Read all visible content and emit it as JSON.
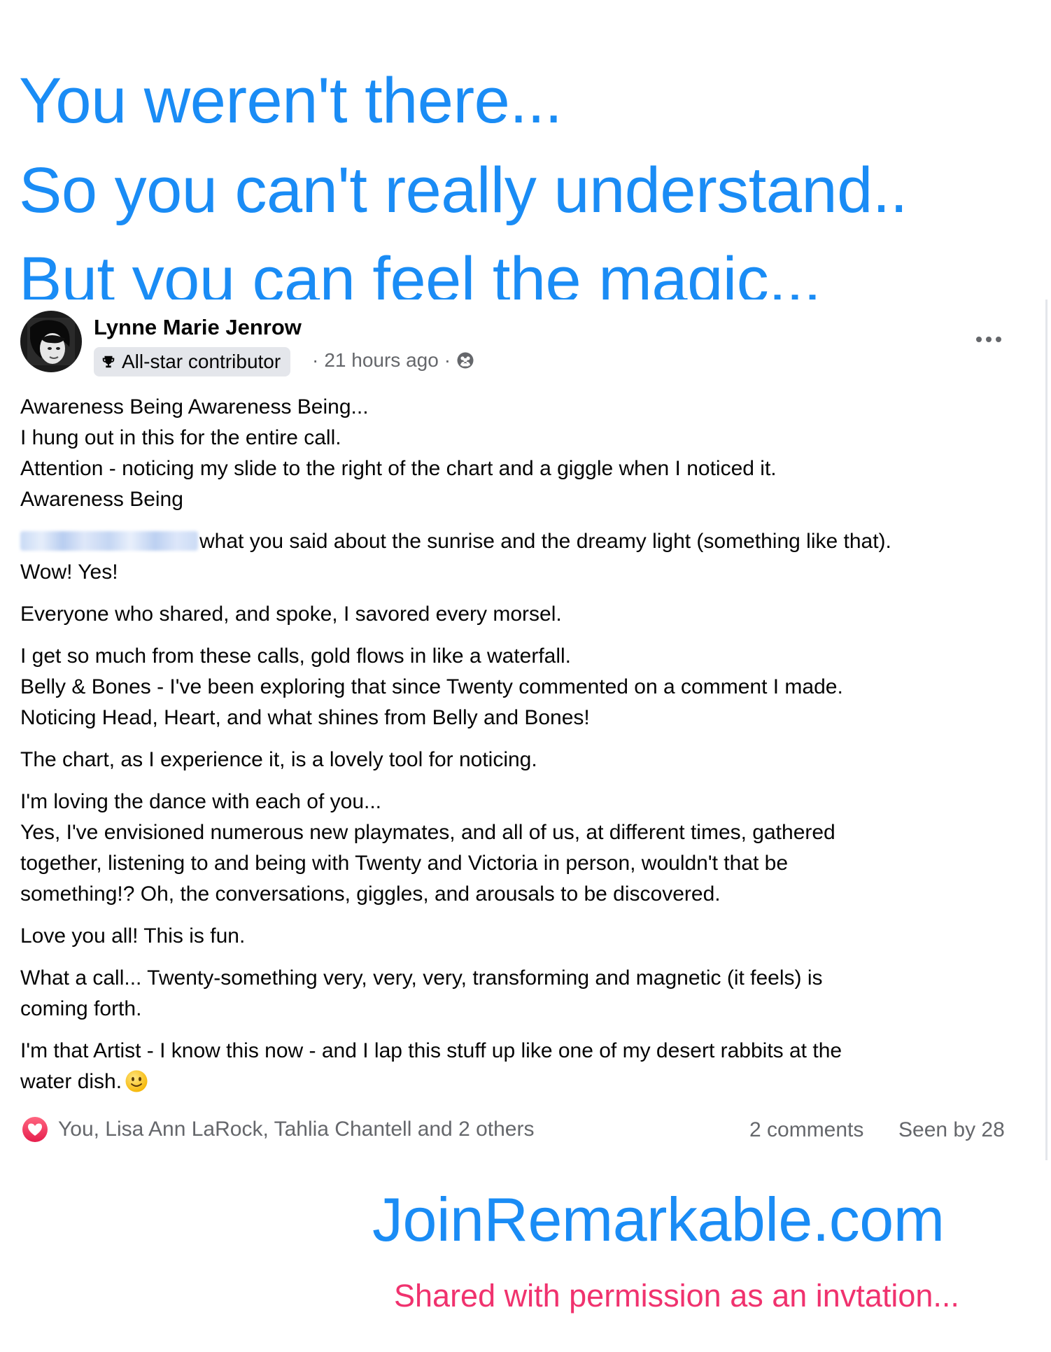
{
  "headline": {
    "line1": "You weren't there...",
    "line2": "So you can't really understand..",
    "line3": "But you can feel the magic..."
  },
  "post": {
    "author": "Lynne Marie Jenrow",
    "badge": "All-star contributor",
    "time_sep": "·",
    "time": "21 hours ago",
    "privacy_sep": "·",
    "paragraphs": [
      [
        "Awareness Being Awareness Being...",
        "I hung out in this for the entire call.",
        "Attention - noticing my slide to the right of the chart and a giggle when I noticed it.",
        "Awareness Being"
      ],
      [
        "what you said about the sunrise and the dreamy light (something like that).",
        "Wow!  Yes!"
      ],
      [
        "Everyone who shared, and spoke, I savored every morsel."
      ],
      [
        "I get so much from these calls, gold flows in like a waterfall.",
        "Belly & Bones - I've been exploring that since Twenty commented on a comment I made.",
        "Noticing Head, Heart, and what shines from Belly and Bones!"
      ],
      [
        "The chart, as I experience it, is a lovely tool for noticing."
      ],
      [
        "I'm loving the dance with each of you...",
        "Yes, I've envisioned numerous new playmates, and all of us, at different times, gathered",
        "together, listening to and being with Twenty and Victoria in person, wouldn't that be",
        "something!?  Oh, the conversations, giggles, and arousals to be discovered."
      ],
      [
        "Love you all!  This is fun."
      ],
      [
        "What a call... Twenty-something very, very, very, transforming and magnetic (it feels)  is",
        "coming forth."
      ],
      [
        "I'm that Artist - I know this now  - and I lap this stuff up like one of my desert rabbits at the",
        "water dish."
      ]
    ],
    "reactions": "You, Lisa Ann LaRock, Tahlia Chantell and 2 others",
    "comments": "2 comments",
    "seen": "Seen by 28"
  },
  "footer": {
    "site": "JoinRemarkable.com",
    "shared": "Shared with permission as an invtation..."
  },
  "icons": {
    "badge": "trophy-icon",
    "privacy": "group-privacy-icon",
    "more": "more-options-icon",
    "reaction": "heart-reaction-icon",
    "emoji": "slightly-smiling-face-emoji"
  },
  "colors": {
    "headline": "#1a8cf5",
    "shared_note": "#f0326e",
    "reaction_heart": "#f33e58",
    "muted_text": "#65676b",
    "badge_bg": "#e4e6eb"
  }
}
